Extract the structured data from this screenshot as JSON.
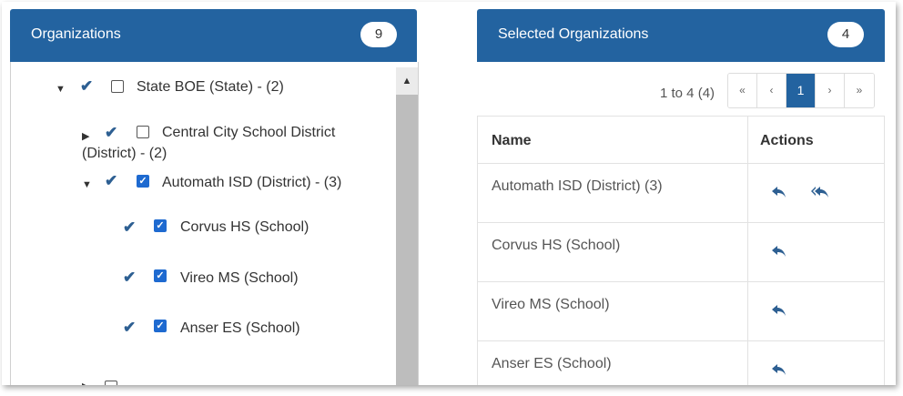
{
  "organizations": {
    "title": "Organizations",
    "count": "9",
    "tree": [
      {
        "label": "State BOE (State) - (2)",
        "expanded": true,
        "checked": false
      },
      {
        "label_line1": "Central City School District",
        "label_line2": "(District) - (2)",
        "expanded": false,
        "checked": false
      },
      {
        "label": "Automath ISD (District) - (3)",
        "expanded": true,
        "checked": true
      },
      {
        "label": "Corvus HS (School)",
        "checked": true
      },
      {
        "label": "Vireo MS (School)",
        "checked": true
      },
      {
        "label": "Anser ES (School)",
        "checked": true
      }
    ]
  },
  "selected": {
    "title": "Selected Organizations",
    "count": "4",
    "pager": {
      "range": "1 to 4 (4)",
      "first": "«",
      "prev": "‹",
      "current": "1",
      "next": "›",
      "last": "»"
    },
    "columns": {
      "name": "Name",
      "actions": "Actions"
    },
    "rows": [
      {
        "name": "Automath ISD (District) (3)",
        "actions": [
          "reply-icon",
          "reply-all-icon"
        ]
      },
      {
        "name": "Corvus HS (School)",
        "actions": [
          "reply-icon"
        ]
      },
      {
        "name": "Vireo MS (School)",
        "actions": [
          "reply-icon"
        ]
      },
      {
        "name": "Anser ES (School)",
        "actions": [
          "reply-icon"
        ]
      }
    ]
  },
  "colors": {
    "header": "#2363a0",
    "check": "#1e6ad0",
    "icon": "#2d5f92"
  }
}
